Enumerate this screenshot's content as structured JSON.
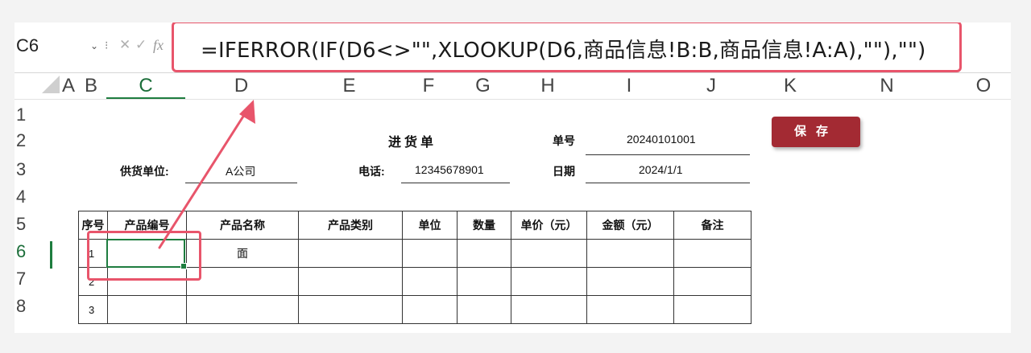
{
  "formula_bar": {
    "name_box": "C6",
    "dropdown_glyph": "⌄",
    "separator_glyph": "⁝",
    "cancel_glyph": "✕",
    "enter_glyph": "✓",
    "fx_glyph": "fx",
    "formula": "=IFERROR(IF(D6<>\"\",XLOOKUP(D6,商品信息!B:B,商品信息!A:A),\"\"),\"\")"
  },
  "columns": [
    "A",
    "B",
    "C",
    "D",
    "E",
    "F",
    "G",
    "H",
    "I",
    "J",
    "K",
    "N",
    "O"
  ],
  "selected_column": "C",
  "rows": [
    "1",
    "2",
    "3",
    "4",
    "5",
    "6",
    "7",
    "8"
  ],
  "selected_row": "6",
  "sheet": {
    "title": "进货单",
    "order_no_label": "单号",
    "order_no_value": "20240101001",
    "supplier_label": "供货单位:",
    "supplier_value": "A公司",
    "phone_label": "电话:",
    "phone_value": "12345678901",
    "date_label": "日期",
    "date_value": "2024/1/1",
    "save_button": "保存"
  },
  "table": {
    "headers": [
      "序号",
      "产品编号",
      "产品名称",
      "产品类别",
      "单位",
      "数量",
      "单价（元）",
      "金额（元）",
      "备注"
    ],
    "rows": [
      [
        "1",
        "",
        "面",
        "",
        "",
        "",
        "",
        "",
        ""
      ],
      [
        "2",
        "",
        "",
        "",
        "",
        "",
        "",
        "",
        ""
      ],
      [
        "3",
        "",
        "",
        "",
        "",
        "",
        "",
        "",
        ""
      ]
    ]
  },
  "colors": {
    "highlight": "#e8556b",
    "selection": "#1e7d3f",
    "save_button": "#a32a33"
  }
}
